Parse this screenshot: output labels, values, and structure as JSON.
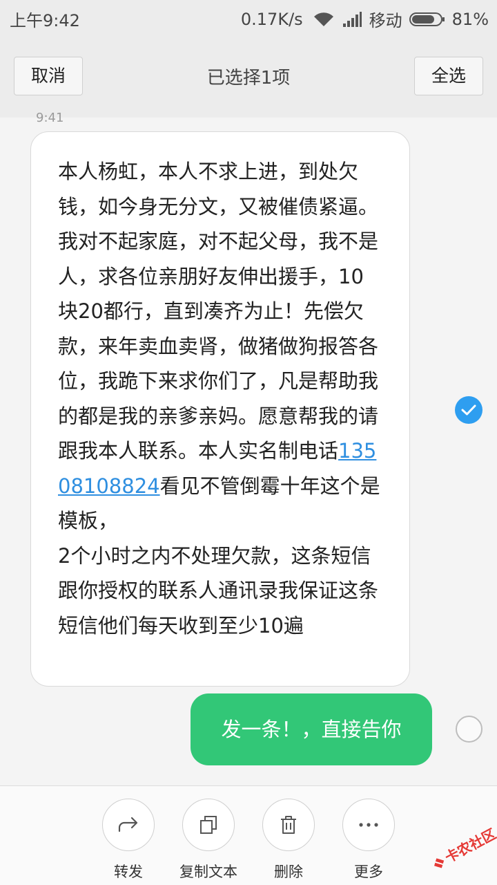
{
  "status_bar": {
    "time": "上午9:42",
    "speed": "0.17K/s",
    "carrier": "移动",
    "battery": "81%",
    "battery_level": 0.81
  },
  "header": {
    "cancel_label": "取消",
    "title": "已选择1项",
    "select_all_label": "全选"
  },
  "conversation": {
    "timestamp": "9:41",
    "incoming": {
      "text_before_link": "本人杨虹，本人不求上进，到处欠钱，如今身无分文，又被催债紧逼。我对不起家庭，对不起父母，我不是人，求各位亲朋好友伸出援手，10块20都行，直到凑齐为止！先偿欠款，来年卖血卖肾，做猪做狗报答各位，我跪下来求你们了，凡是帮助我的都是我的亲爹亲妈。愿意帮我的请跟我本人联系。本人实名制电话",
      "link_text": "13508108824",
      "text_after_link": "看见不管倒霉十年这个是模板，",
      "text_second_paragraph": "2个小时之内不处理欠款，这条短信跟你授权的联系人通讯录我保证这条短信他们每天收到至少10遍",
      "selected": true
    },
    "outgoing": {
      "text": "发一条！，直接告你",
      "selected": false
    }
  },
  "toolbar": {
    "items": [
      {
        "label": "转发",
        "icon": "forward-icon"
      },
      {
        "label": "复制文本",
        "icon": "copy-icon"
      },
      {
        "label": "删除",
        "icon": "trash-icon"
      },
      {
        "label": "更多",
        "icon": "more-icon"
      }
    ]
  },
  "watermark": {
    "text": "卡农社区"
  },
  "colors": {
    "incoming_bg": "#ffffff",
    "outgoing_bg": "#32c777",
    "check_selected": "#2e9ef0",
    "link": "#2f8fe0"
  }
}
